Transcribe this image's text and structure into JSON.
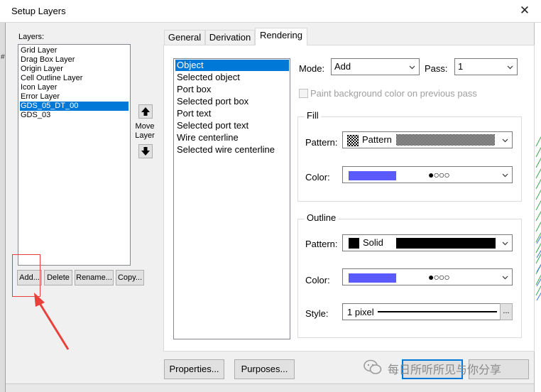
{
  "window": {
    "title": "Setup Layers",
    "close_glyph": "✕"
  },
  "background": {
    "left_fragment": "#"
  },
  "layers": {
    "label": "Layers:",
    "items": [
      {
        "label": "Grid Layer",
        "selected": false
      },
      {
        "label": "Drag Box Layer",
        "selected": false
      },
      {
        "label": "Origin Layer",
        "selected": false
      },
      {
        "label": "Cell Outline Layer",
        "selected": false
      },
      {
        "label": "Icon Layer",
        "selected": false
      },
      {
        "label": "Error Layer",
        "selected": false
      },
      {
        "label": "GDS_05_DT_00",
        "selected": true
      },
      {
        "label": "GDS_03",
        "selected": false
      }
    ],
    "move_label_1": "Move",
    "move_label_2": "Layer",
    "move_up_icon": "arrow-up-icon",
    "move_down_icon": "arrow-down-icon",
    "buttons": {
      "add": "Add...",
      "delete": "Delete",
      "rename": "Rename...",
      "copy": "Copy..."
    }
  },
  "tabs": [
    {
      "label": "General",
      "active": false
    },
    {
      "label": "Derivation",
      "active": false
    },
    {
      "label": "Rendering",
      "active": true
    }
  ],
  "objects": {
    "items": [
      {
        "label": "Object",
        "selected": true
      },
      {
        "label": "Selected object",
        "selected": false
      },
      {
        "label": "Port box",
        "selected": false
      },
      {
        "label": "Selected port box",
        "selected": false
      },
      {
        "label": "Port text",
        "selected": false
      },
      {
        "label": "Selected port text",
        "selected": false
      },
      {
        "label": "Wire centerline",
        "selected": false
      },
      {
        "label": "Selected wire centerline",
        "selected": false
      }
    ]
  },
  "rendering": {
    "mode_label": "Mode:",
    "mode_value": "Add",
    "pass_label": "Pass:",
    "pass_value": "1",
    "paint_bg_label": "Paint background color on previous pass",
    "paint_bg_checked": false,
    "fill": {
      "title": "Fill",
      "pattern_label": "Pattern:",
      "pattern_value": "Pattern",
      "color_label": "Color:",
      "color_value": "#5a5aff",
      "dots": "●○○○"
    },
    "outline": {
      "title": "Outline",
      "pattern_label": "Pattern:",
      "pattern_value": "Solid",
      "color_label": "Color:",
      "color_value": "#5a5aff",
      "dots": "●○○○",
      "style_label": "Style:",
      "style_value": "1 pixel",
      "style_more": "..."
    }
  },
  "footer": {
    "properties": "Properties...",
    "purposes": "Purposes...",
    "watermark": "每日所听所见与你分享"
  },
  "colors": {
    "accent": "#0078d7",
    "annotation_red": "#e8403a",
    "swatch_blue": "#5a5aff"
  }
}
